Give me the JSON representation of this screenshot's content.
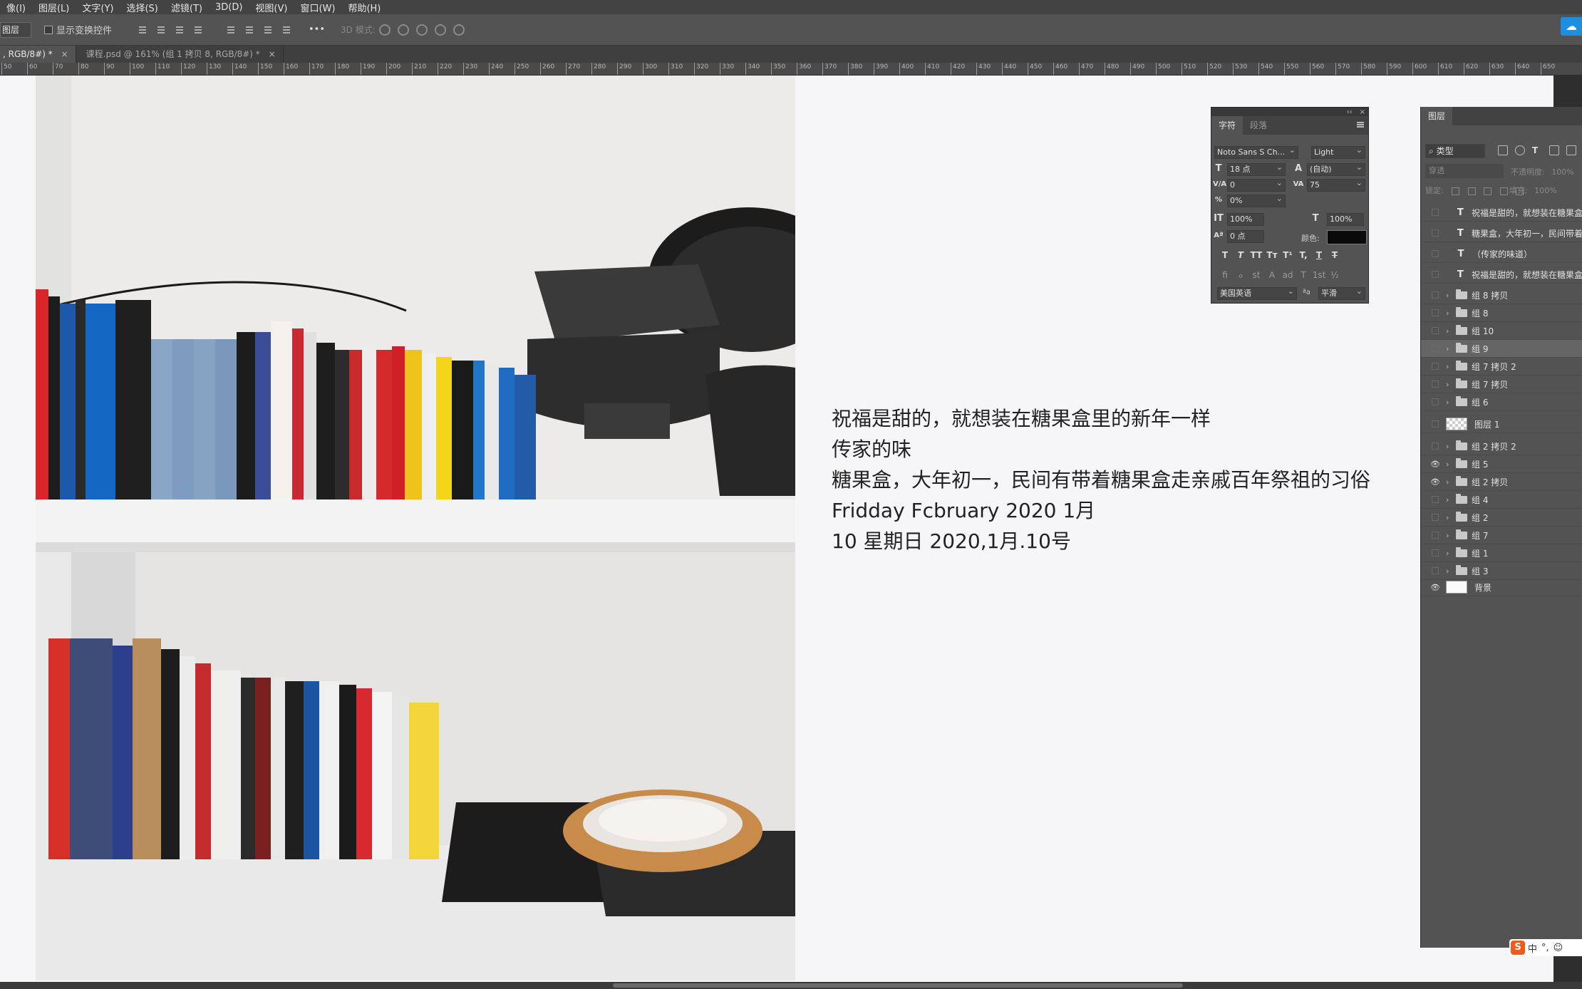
{
  "menubar": {
    "items": [
      "像(I)",
      "图层(L)",
      "文字(Y)",
      "选择(S)",
      "滤镜(T)",
      "3D(D)",
      "视图(V)",
      "窗口(W)",
      "帮助(H)"
    ]
  },
  "options_bar": {
    "target_select": "图层",
    "show_transform_label": "显示变换控件",
    "more_label": "•••",
    "mode3d_label": "3D 模式:"
  },
  "tabs": [
    {
      "label": ", RGB/8#) *",
      "close": "×"
    },
    {
      "label": "课程.psd @ 161% (组 1 拷贝 8, RGB/8#) *",
      "close": "×"
    }
  ],
  "ruler": {
    "ticks": [
      "50",
      "60",
      "70",
      "80",
      "90",
      "100",
      "110",
      "120",
      "130",
      "140",
      "150",
      "160",
      "170",
      "180",
      "190",
      "200",
      "210",
      "220",
      "230",
      "240",
      "250",
      "260",
      "270",
      "280",
      "290",
      "300",
      "310",
      "320",
      "330",
      "340",
      "350",
      "360",
      "370",
      "380",
      "390",
      "400",
      "410",
      "420",
      "430",
      "440",
      "450",
      "460",
      "470",
      "480",
      "490",
      "500",
      "510",
      "520",
      "530",
      "540",
      "550",
      "560",
      "570",
      "580",
      "590",
      "600",
      "610",
      "620",
      "630",
      "640",
      "650"
    ]
  },
  "canvas": {
    "text_lines": [
      "祝福是甜的，就想装在糖果盒里的新年一样",
      "传家的味",
      "糖果盒，大年初一，民间有带着糖果盒走亲戚百年祭祖的习俗",
      "Fridday  Fcbruary   2020 1月",
      "10 星期日 2020,1月.10号"
    ]
  },
  "character_panel": {
    "tab_character": "字符",
    "tab_paragraph": "段落",
    "font_family": "Noto Sans S Ch...",
    "font_style": "Light",
    "font_size": "18 点",
    "leading": "(自动)",
    "kerning": "0",
    "tracking": "75",
    "tsume": "0%",
    "vertical_scale": "100%",
    "horizontal_scale": "100%",
    "baseline_shift": "0 点",
    "color_label": "颜色:",
    "language": "美国英语",
    "aa_label": "ªa",
    "antialias": "平滑",
    "style_buttons": [
      "T",
      "T",
      "TT",
      "Tт",
      "T¹",
      "T,",
      "T",
      "T"
    ],
    "opentype_buttons": [
      "fi",
      "ℴ",
      "st",
      "A",
      "ad",
      "T",
      "1st",
      "½"
    ]
  },
  "layers_panel": {
    "tab_label": "图层",
    "filter_kind": "类型",
    "blend_mode": "穿透",
    "opacity_label": "不透明度:",
    "opacity_value": "100%",
    "lock_label": "锁定:",
    "fill_label": "填充:",
    "fill_value": "100%",
    "layers": [
      {
        "kind": "text",
        "name": "祝福是甜的，就想装在糖果盒",
        "visible": false,
        "selected": false
      },
      {
        "kind": "text",
        "name": "糖果盒，大年初一，民间带着",
        "visible": false,
        "selected": false
      },
      {
        "kind": "text",
        "name": "（传家的味道）",
        "visible": false,
        "selected": false
      },
      {
        "kind": "text",
        "name": "祝福是甜的，就想装在糖果盒",
        "visible": false,
        "selected": false
      },
      {
        "kind": "group",
        "name": "组 8 拷贝",
        "visible": false,
        "selected": false
      },
      {
        "kind": "group",
        "name": "组 8",
        "visible": false,
        "selected": false
      },
      {
        "kind": "group",
        "name": "组 10",
        "visible": false,
        "selected": false
      },
      {
        "kind": "group",
        "name": "组 9",
        "visible": false,
        "selected": true
      },
      {
        "kind": "group",
        "name": "组 7 拷贝 2",
        "visible": false,
        "selected": false
      },
      {
        "kind": "group",
        "name": "组 7 拷贝",
        "visible": false,
        "selected": false
      },
      {
        "kind": "group",
        "name": "组 6",
        "visible": false,
        "selected": false
      },
      {
        "kind": "pixel",
        "name": "图层 1",
        "visible": false,
        "selected": false
      },
      {
        "kind": "group",
        "name": "组 2 拷贝 2",
        "visible": false,
        "selected": false
      },
      {
        "kind": "group",
        "name": "组 5",
        "visible": true,
        "selected": false
      },
      {
        "kind": "group",
        "name": "组 2 拷贝",
        "visible": true,
        "selected": false
      },
      {
        "kind": "group",
        "name": "组 4",
        "visible": false,
        "selected": false
      },
      {
        "kind": "group",
        "name": "组 2",
        "visible": false,
        "selected": false
      },
      {
        "kind": "group",
        "name": "组 7",
        "visible": false,
        "selected": false
      },
      {
        "kind": "group",
        "name": "组 1",
        "visible": false,
        "selected": false
      },
      {
        "kind": "group",
        "name": "组 3",
        "visible": false,
        "selected": false
      },
      {
        "kind": "background",
        "name": "背景",
        "visible": true,
        "selected": false
      }
    ]
  },
  "ime": {
    "logo": "S",
    "mode": "中"
  },
  "colors": {
    "ui_bg": "#535353",
    "canvas_bg": "#f6f6f8",
    "text_color_swatch": "#0a0a0a",
    "cloud_button": "#1d8fe0"
  }
}
